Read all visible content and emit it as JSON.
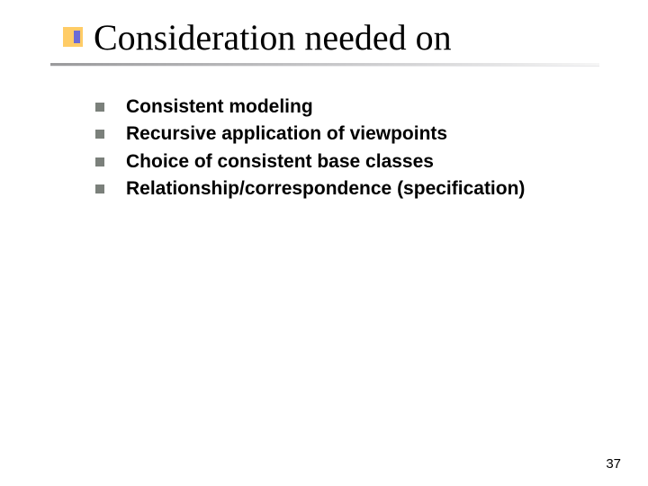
{
  "slide": {
    "title": "Consideration needed on",
    "bullets": [
      "Consistent modeling",
      "Recursive application of viewpoints",
      "Choice of consistent base classes",
      "Relationship/correspondence (specification)"
    ],
    "page_number": "37"
  }
}
